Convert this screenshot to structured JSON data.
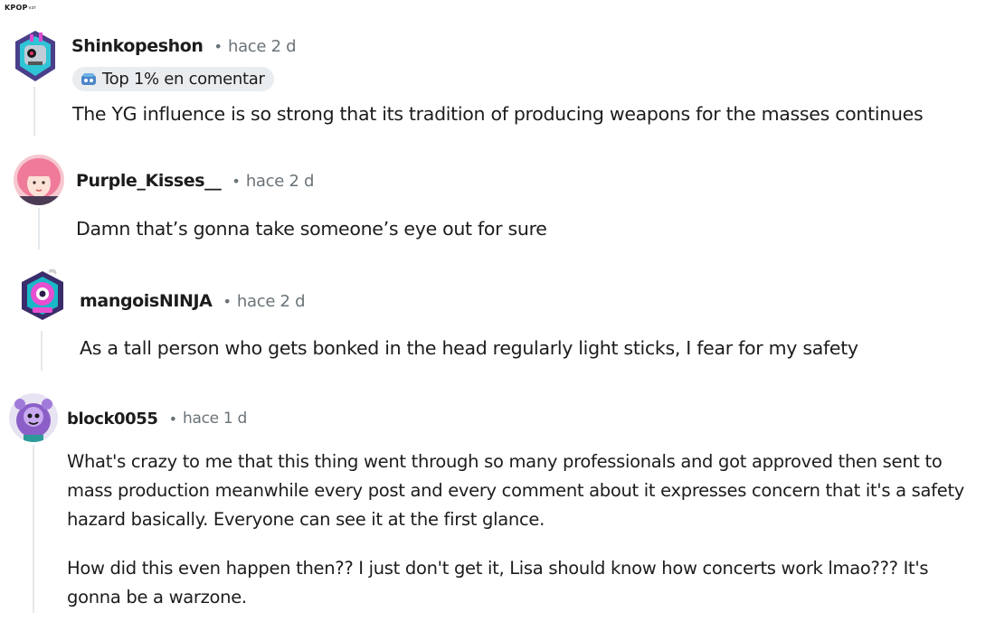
{
  "watermark": {
    "brand": "KPOP",
    "suffix": "vzr"
  },
  "comments": [
    {
      "username": "Shinkopeshon",
      "time": "hace 2 d",
      "badge": "Top 1% en comentar",
      "paragraphs": [
        [
          "The YG influence is so strong that its tradition of producing weapons for the masses continues"
        ]
      ]
    },
    {
      "username": "Purple_Kisses__",
      "time": "hace 2 d",
      "paragraphs": [
        [
          "Damn that’s gonna take someone’s eye out for sure"
        ]
      ]
    },
    {
      "username": "mangoisNINJA",
      "time": "hace 2 d",
      "paragraphs": [
        [
          "As a tall person who gets bonked in the head regularly light sticks, I fear for my safety"
        ]
      ]
    },
    {
      "username": "block0055",
      "time": "hace 1 d",
      "paragraphs": [
        [
          "What's crazy to me that this thing went through so many professionals and got approved then sent to",
          "mass production meanwhile every post and every comment about it expresses concern that it's a safety",
          "hazard basically. Everyone can see it at the first glance."
        ],
        [
          "How did this even happen then?? I just don't get it, Lisa should know how concerts work lmao??? It's",
          "gonna be a warzone."
        ]
      ]
    }
  ],
  "icons": {
    "badge": "commenter-badge-icon",
    "avatars": [
      "robot-avatar-icon",
      "pink-hair-avatar-photo",
      "ninja-avatar-icon",
      "purple-creature-avatar-icon"
    ]
  },
  "colors": {
    "text": "#1c1c1c",
    "meta": "#6a7378",
    "thread_line": "#e5e8ea",
    "badge_bg": "#eaedef"
  }
}
